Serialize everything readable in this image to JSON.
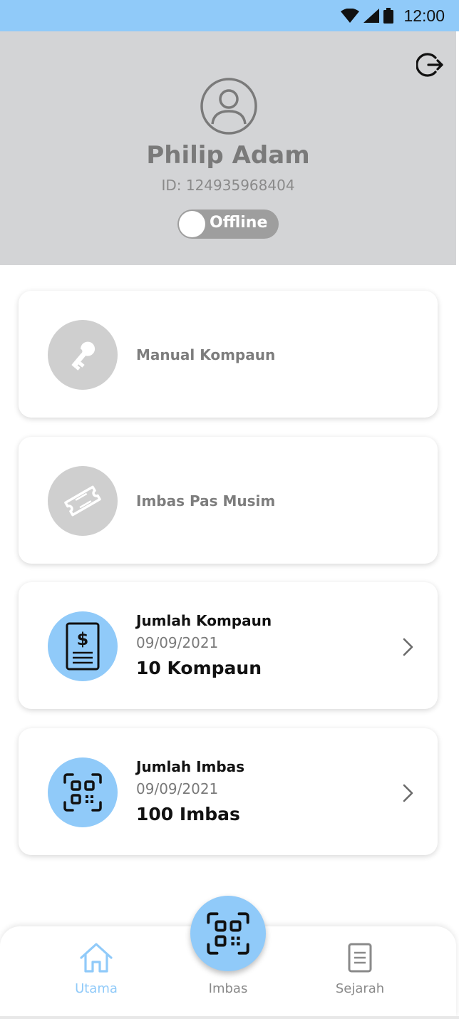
{
  "status_bar": {
    "time": "12:00",
    "icons": [
      "wifi-icon",
      "signal-icon",
      "battery-icon"
    ],
    "background": "#90caf9"
  },
  "profile": {
    "name": "Philip Adam",
    "id_text": "ID: 124935968404",
    "status_label": "Offline",
    "status_online": false,
    "background": "#d3d4d6",
    "icons": [
      "logout-icon",
      "user-icon"
    ]
  },
  "menu": [
    {
      "label": "Manual Kompaun",
      "icon": "key-icon",
      "enabled": false
    },
    {
      "label": "Imbas Pas Musim",
      "icon": "ticket-icon",
      "enabled": false
    }
  ],
  "stats": [
    {
      "title": "Jumlah Kompaun",
      "date": "09/09/2021",
      "value": "10 Kompaun",
      "icon": "receipt-icon"
    },
    {
      "title": "Jumlah Imbas",
      "date": "09/09/2021",
      "value": "100 Imbas",
      "icon": "qr-code-icon"
    }
  ],
  "bottom_nav": {
    "items": [
      {
        "label": "Utama",
        "icon": "home-icon",
        "active": true
      },
      {
        "label": "Imbas",
        "icon": "qr-scan-icon",
        "active": false
      },
      {
        "label": "Sejarah",
        "icon": "document-icon",
        "active": false
      }
    ]
  },
  "colors": {
    "accent": "#90caf9",
    "disabled_circle": "#cfcfcf",
    "text_dark": "#111111",
    "text_grey": "#7a7a7a"
  }
}
